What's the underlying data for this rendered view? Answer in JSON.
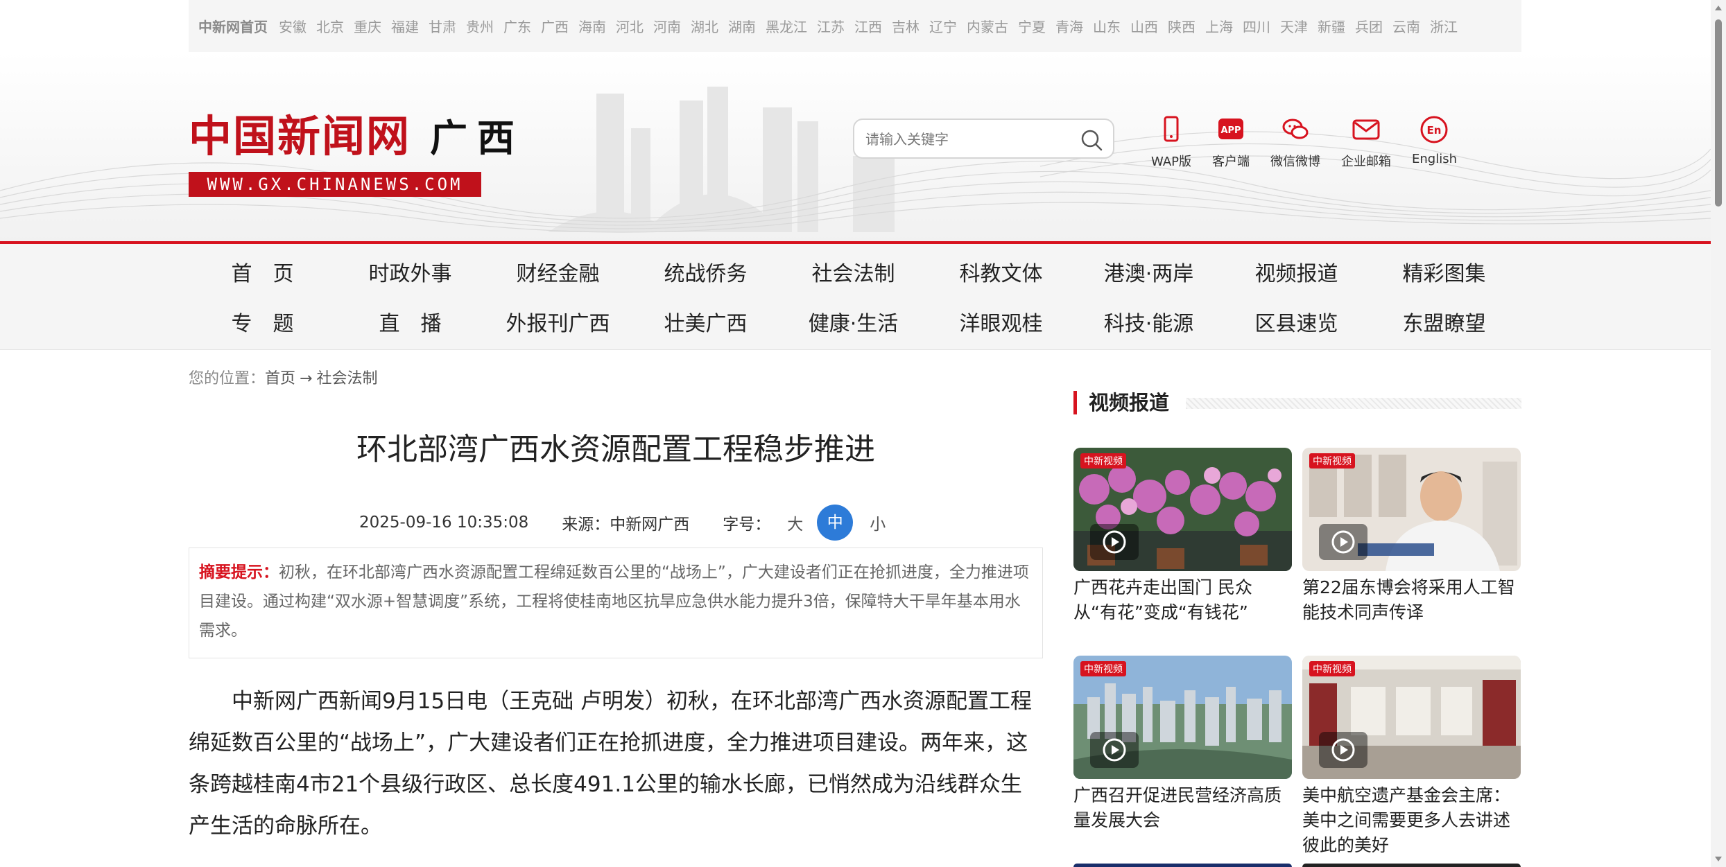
{
  "region_bar": {
    "home": "中新网首页",
    "regions": [
      "安徽",
      "北京",
      "重庆",
      "福建",
      "甘肃",
      "贵州",
      "广东",
      "广西",
      "海南",
      "河北",
      "河南",
      "湖北",
      "湖南",
      "黑龙江",
      "江苏",
      "江西",
      "吉林",
      "辽宁",
      "内蒙古",
      "宁夏",
      "青海",
      "山东",
      "山西",
      "陕西",
      "上海",
      "四川",
      "天津",
      "新疆",
      "兵团",
      "云南",
      "浙江"
    ]
  },
  "header": {
    "logo_cn": "中国新闻网",
    "logo_region": "广西",
    "logo_url": "WWW.GX.CHINANEWS.COM",
    "search_placeholder": "请输入关键字",
    "tools": [
      {
        "icon": "mobile-icon",
        "label": "WAP版"
      },
      {
        "icon": "app-icon",
        "label": "客户端"
      },
      {
        "icon": "wechat-weibo-icon",
        "label": "微信微博"
      },
      {
        "icon": "mail-icon",
        "label": "企业邮箱"
      },
      {
        "icon": "english-icon",
        "label": "English"
      }
    ],
    "accent_color": "#d7131f"
  },
  "nav": {
    "row1": [
      "首　页",
      "时政外事",
      "财经金融",
      "统战侨务",
      "社会法制",
      "科教文体",
      "港澳·两岸",
      "视频报道",
      "精彩图集"
    ],
    "row2": [
      "专　题",
      "直　播",
      "外报刊广西",
      "壮美广西",
      "健康·生活",
      "洋眼观桂",
      "科技·能源",
      "区县速览",
      "东盟瞭望"
    ]
  },
  "breadcrumb": {
    "prefix": "您的位置：",
    "home": "首页",
    "sep": "→",
    "current": "社会法制"
  },
  "article": {
    "title": "环北部湾广西水资源配置工程稳步推进",
    "datetime": "2025-09-16 10:35:08",
    "source": "来源：中新网广西",
    "font_label": "字号：",
    "font_large": "大",
    "font_medium": "中",
    "font_small": "小",
    "summary_label": "摘要提示：",
    "summary": "初秋，在环北部湾广西水资源配置工程绵延数百公里的“战场上”，广大建设者们正在抢抓进度，全力推进项目建设。通过构建“双水源+智慧调度”系统，工程将使桂南地区抗旱应急供水能力提升3倍，保障特大干旱年基本用水需求。",
    "paragraph1": "中新网广西新闻9月15日电（王克础 卢明发）初秋，在环北部湾广西水资源配置工程绵延数百公里的“战场上”，广大建设者们正在抢抓进度，全力推进项目建设。两年来，这条跨越桂南4市21个县级行政区、总长度491.1公里的输水长廊，已悄然成为沿线群众生产生活的命脉所在。"
  },
  "sidebar": {
    "heading": "视频报道",
    "videos": [
      {
        "badge": "中新视频",
        "caption": "广西花卉走出国门 民众从“有花”变成“有钱花”"
      },
      {
        "badge": "中新视频",
        "caption": "第22届东博会将采用人工智能技术同声传译"
      },
      {
        "badge": "中新视频",
        "caption": "广西召开促进民营经济高质量发展大会"
      },
      {
        "badge": "中新视频",
        "caption": "美中航空遗产基金会主席：美中之间需要更多人去讲述彼此的美好"
      }
    ]
  }
}
